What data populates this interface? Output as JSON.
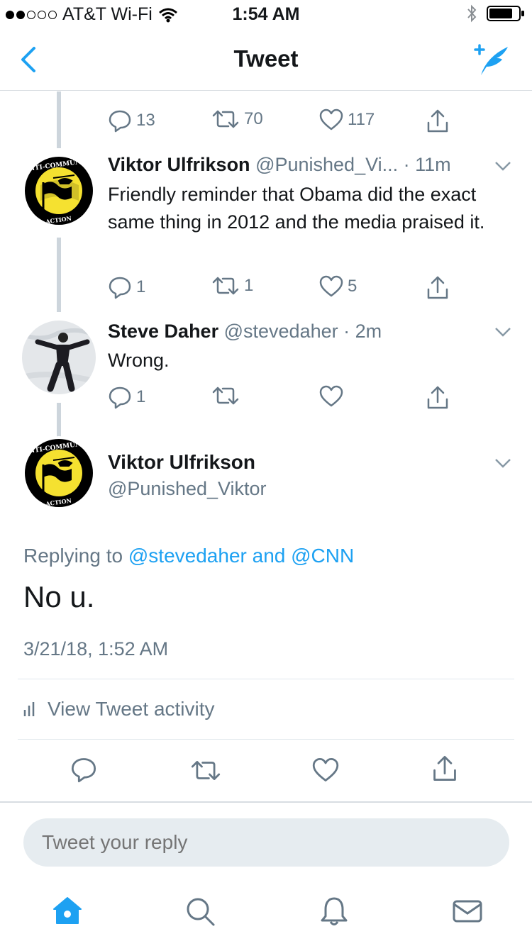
{
  "statusbar": {
    "carrier": "AT&T Wi-Fi",
    "time": "1:54 AM"
  },
  "nav": {
    "title": "Tweet"
  },
  "top_actions": {
    "reply_count": "13",
    "retweet_count": "70",
    "like_count": "117"
  },
  "tweets": [
    {
      "name": "Viktor Ulfrikson",
      "handle": "@Punished_Vi...",
      "time": "· 11m",
      "text": "Friendly reminder that Obama did the exact same thing in 2012 and the media praised it.",
      "reply_count": "1",
      "retweet_count": "1",
      "like_count": "5"
    },
    {
      "name": "Steve Daher",
      "handle": "@stevedaher",
      "time": "· 2m",
      "text": "Wrong.",
      "reply_count": "1",
      "retweet_count": "",
      "like_count": ""
    }
  ],
  "main_tweet": {
    "name": "Viktor Ulfrikson",
    "handle": "@Punished_Viktor",
    "replying_prefix": "Replying to ",
    "replying_to": "@stevedaher and @CNN",
    "text": "No u.",
    "date": "3/21/18, 1:52 AM",
    "activity_label": "View Tweet activity"
  },
  "reply": {
    "placeholder": "Tweet your reply"
  },
  "avatar_logo": {
    "top_text": "ANTI-COMMUNIST",
    "bottom_text": "ACTION"
  },
  "colors": {
    "accent": "#1da1f2",
    "gray": "#657786",
    "logo_yellow": "#f5e130"
  },
  "icons": [
    "back-icon",
    "compose-icon",
    "reply-icon",
    "retweet-icon",
    "like-icon",
    "share-icon",
    "chevron-down-icon",
    "activity-icon",
    "home-icon",
    "search-icon",
    "notifications-icon",
    "messages-icon"
  ]
}
